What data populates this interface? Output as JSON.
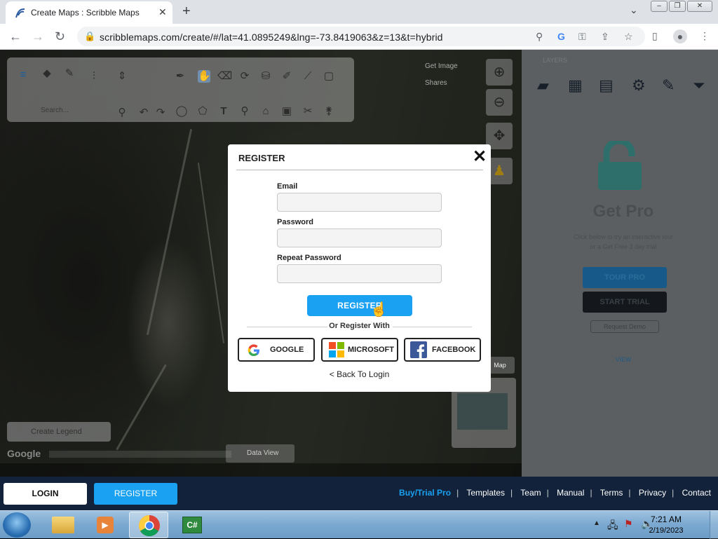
{
  "browser": {
    "tab_title": "Create Maps : Scribble Maps",
    "url": "scribblemaps.com/create/#/lat=41.0895249&lng=-73.8419063&z=13&t=hybrid"
  },
  "map": {
    "toolbar_search_placeholder": "Search...",
    "get_image": "Get Image",
    "shares": "Shares",
    "create_legend": "Create Legend",
    "data_view": "Data View",
    "map_toggle": "Map",
    "google_logo": "Google"
  },
  "pro_panel": {
    "layers_label": "LAYERS",
    "title": "Get Pro",
    "description_line1": "Click below to try an interactive tour",
    "description_line2": "or a Get Free 3 day trial",
    "tour_pro": "TOUR PRO",
    "start_trial": "START TRIAL",
    "request_demo": "Request Demo",
    "view_link": "VIEW"
  },
  "modal": {
    "title": "REGISTER",
    "email_label": "Email",
    "email_value": "",
    "password_label": "Password",
    "password_value": "",
    "repeat_password_label": "Repeat Password",
    "repeat_password_value": "",
    "submit_label": "REGISTER",
    "or_text": "Or Register With",
    "google_label": "GOOGLE",
    "microsoft_label": "MICROSOFT",
    "facebook_label": "FACEBOOK",
    "back_to_login": "< Back To Login"
  },
  "sitebar": {
    "login_label": "LOGIN",
    "register_label": "REGISTER",
    "links": {
      "buy_trial_pro": "Buy/Trial Pro",
      "templates": "Templates",
      "team": "Team",
      "manual": "Manual",
      "terms": "Terms",
      "privacy": "Privacy",
      "contact": "Contact"
    }
  },
  "taskbar": {
    "time": "7:21 AM",
    "date": "2/19/2023"
  },
  "colors": {
    "accent_blue": "#1aa1f2",
    "footer_navy": "#11223a"
  }
}
